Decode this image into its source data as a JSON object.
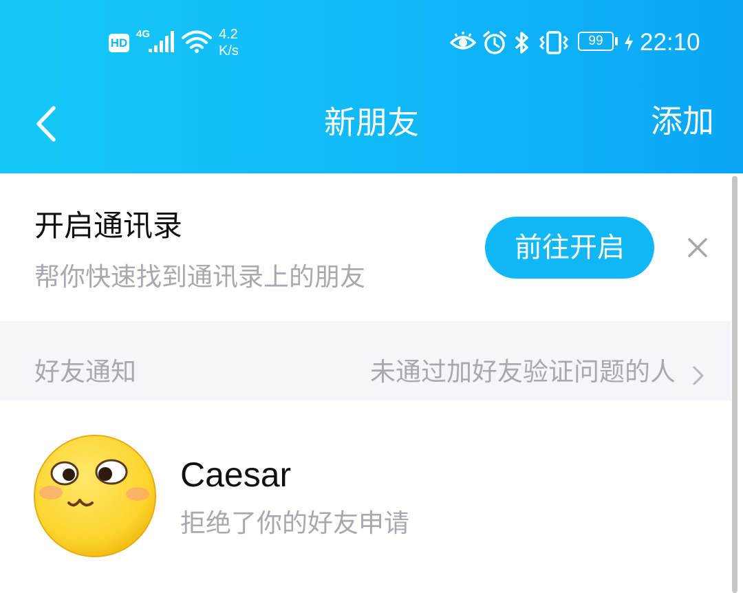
{
  "status_bar": {
    "hd": "HD",
    "network": "4G",
    "speed_value": "4.2",
    "speed_unit": "K/s",
    "battery": "99",
    "time": "22:10"
  },
  "nav": {
    "back_icon": "chevron-left-icon",
    "title": "新朋友",
    "add_label": "添加"
  },
  "contacts_banner": {
    "title": "开启通讯录",
    "subtitle": "帮你快速找到通讯录上的朋友",
    "button_label": "前往开启",
    "close_icon": "close-icon"
  },
  "notifications_section": {
    "label": "好友通知",
    "link": "未通过加好友验证问题的人"
  },
  "friend_requests": [
    {
      "name": "Caesar",
      "status": "拒绝了你的好友申请",
      "avatar": "blushing-face-emoji"
    }
  ],
  "colors": {
    "header_gradient_start": "#15c9f7",
    "header_gradient_end": "#0aa6f5",
    "button": "#12b7f5",
    "section_bg": "#f5f6fa",
    "muted_text": "#a8a8ae"
  }
}
